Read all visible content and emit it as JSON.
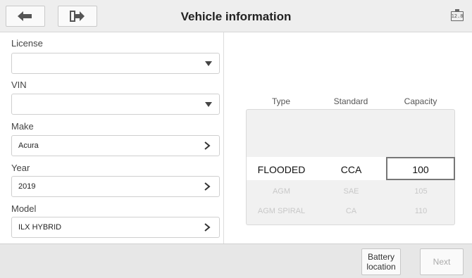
{
  "header": {
    "title": "Vehicle information",
    "battery_label": "12.8"
  },
  "fields": {
    "license": {
      "label": "License",
      "value": ""
    },
    "vin": {
      "label": "VIN",
      "value": ""
    },
    "make": {
      "label": "Make",
      "value": "Acura"
    },
    "year": {
      "label": "Year",
      "value": "2019"
    },
    "model": {
      "label": "Model",
      "value": "ILX HYBRID"
    }
  },
  "battery_table": {
    "headers": [
      "Type",
      "Standard",
      "Capacity"
    ],
    "selected": {
      "type": "FLOODED",
      "standard": "CCA",
      "capacity": "100"
    },
    "rows_below": [
      {
        "type": "AGM",
        "standard": "SAE",
        "capacity": "105"
      },
      {
        "type": "AGM SPIRAL",
        "standard": "CA",
        "capacity": "110"
      }
    ]
  },
  "footer": {
    "battery_location_label": "Battery\nlocation",
    "next_label": "Next"
  }
}
